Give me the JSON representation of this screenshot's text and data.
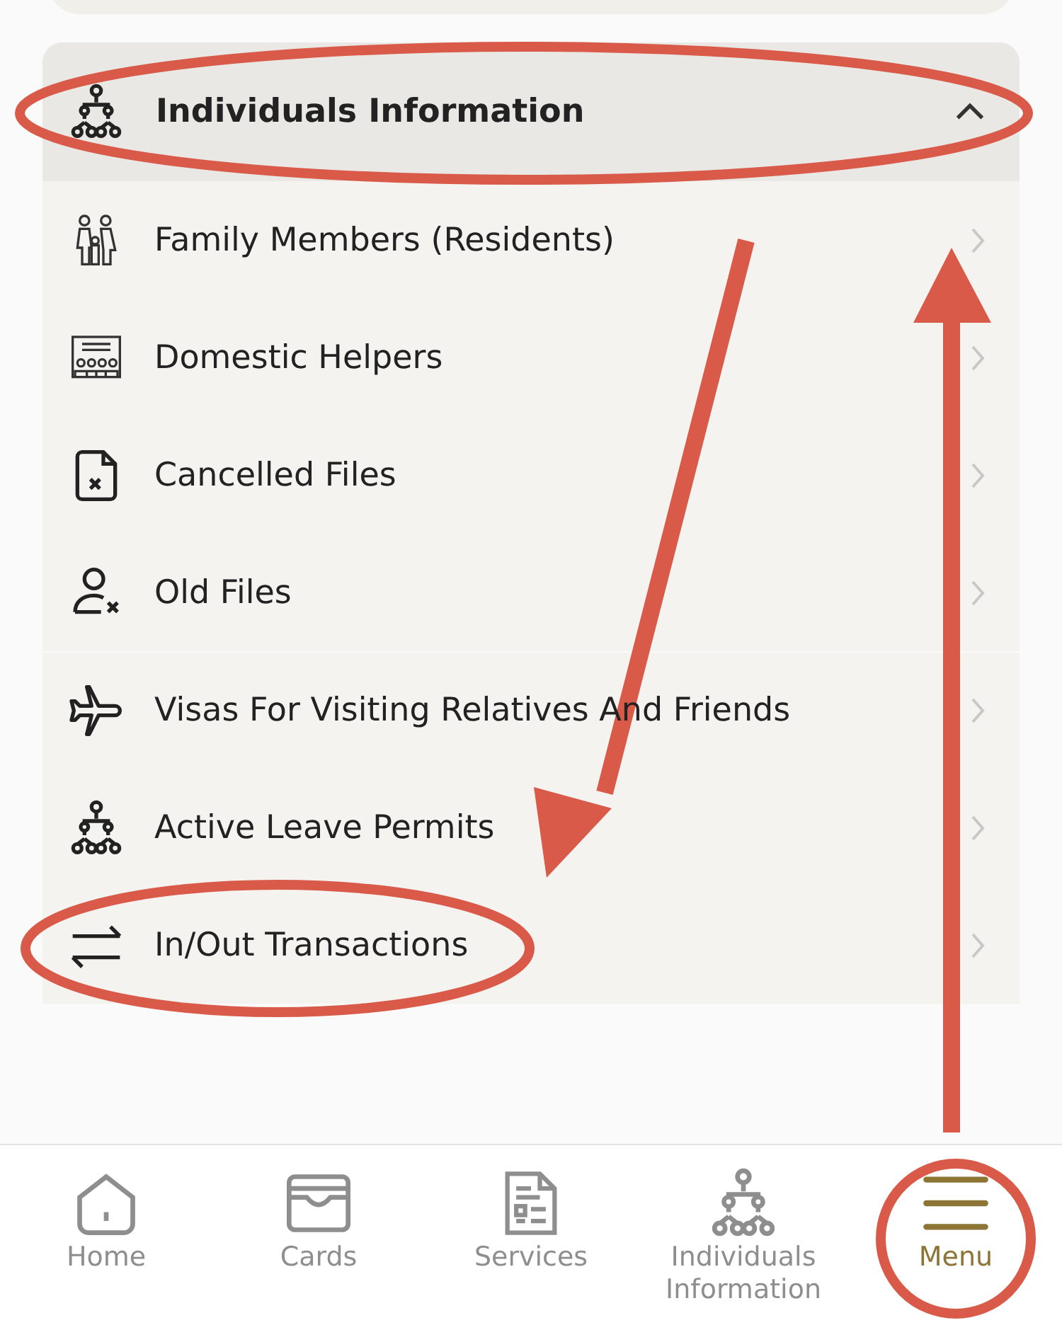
{
  "section": {
    "title": "Individuals Information",
    "expanded": true,
    "items": [
      {
        "label": "Family Members (Residents)",
        "kind": "family"
      },
      {
        "label": "Domestic Helpers",
        "kind": "helpers"
      },
      {
        "label": "Cancelled Files",
        "kind": "cancelled"
      },
      {
        "label": "Old Files",
        "kind": "old"
      },
      {
        "label": "Visas For Visiting Relatives And Friends",
        "kind": "plane"
      },
      {
        "label": "Active Leave Permits",
        "kind": "tree"
      },
      {
        "label": "In/Out Transactions",
        "kind": "swap"
      }
    ]
  },
  "tab_bar": [
    {
      "label": "Home",
      "kind": "home",
      "selected": false
    },
    {
      "label": "Cards",
      "kind": "cards",
      "selected": false
    },
    {
      "label": "Services",
      "kind": "services",
      "selected": false
    },
    {
      "label": "Individuals Information",
      "kind": "tree",
      "selected": false
    },
    {
      "label": "Menu",
      "kind": "menu",
      "selected": true
    }
  ],
  "annotations": [
    {
      "kind": "header-ellipse"
    },
    {
      "kind": "row-ellipse"
    },
    {
      "kind": "menu-circle"
    },
    {
      "kind": "down-arrow"
    },
    {
      "kind": "up-arrow"
    }
  ]
}
